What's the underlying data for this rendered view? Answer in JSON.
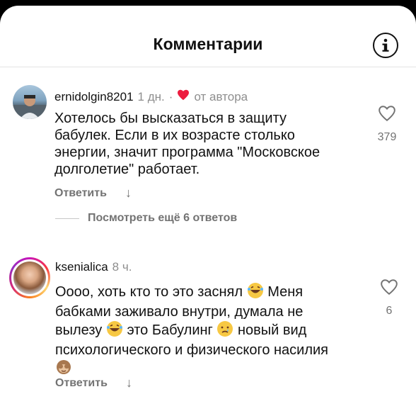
{
  "header": {
    "title": "Комментарии",
    "info_icon": "info-icon"
  },
  "comments": [
    {
      "username": "ernidolgin8201",
      "time": "1 дн.",
      "separator": "·",
      "author_badge": "от автора",
      "author_heart_color": "#ed1c3f",
      "lines": [
        "Хотелось бы высказаться в защиту",
        "бабулек. Если в их возрасте столько",
        "энергии, значит программа \"Московское",
        "долголетие\" работает."
      ],
      "reply_label": "Ответить",
      "like_count": "379"
    },
    {
      "username": "ksenialica",
      "time": "8 ч.",
      "lines": [
        "Оооо, хоть кто то это заснял",
        "Меня",
        "бабками заживало внутри, думала не",
        "вылезу",
        "это Бабулинг",
        "новый вид",
        "психологического и физического насилия"
      ],
      "reply_label": "Ответить",
      "like_count": "6"
    }
  ],
  "view_more_label": "Посмотреть ещё 6 ответов"
}
